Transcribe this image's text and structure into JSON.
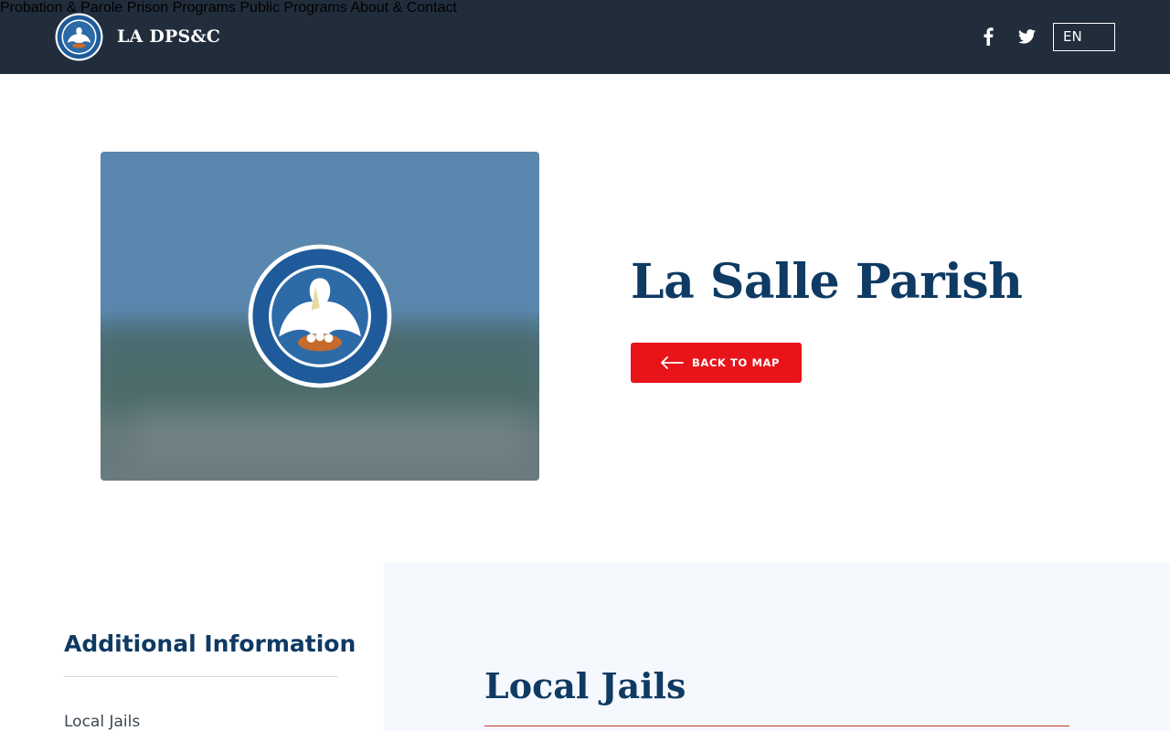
{
  "header": {
    "brand_name": "LA DPS&C",
    "nav": [
      {
        "label": "Probation & Parole"
      },
      {
        "label": "Prison Programs"
      },
      {
        "label": "Public Programs"
      },
      {
        "label": "About & Contact"
      }
    ],
    "social": [
      {
        "icon": "facebook-icon"
      },
      {
        "icon": "twitter-icon"
      }
    ],
    "language": "EN",
    "bg_color": "#222d3c"
  },
  "hero": {
    "title": "La Salle Parish",
    "back_button_label": "BACK TO MAP",
    "back_button_color": "#e8141a",
    "image_icon": "state-seal-icon"
  },
  "sidebar": {
    "title": "Additional Information",
    "links": [
      {
        "label": "Local Jails"
      }
    ]
  },
  "main": {
    "section_title": "Local Jails"
  },
  "colors": {
    "title": "#0e3a63",
    "panel_bg": "#f5f8fc",
    "accent_rule": "#c0392b"
  }
}
